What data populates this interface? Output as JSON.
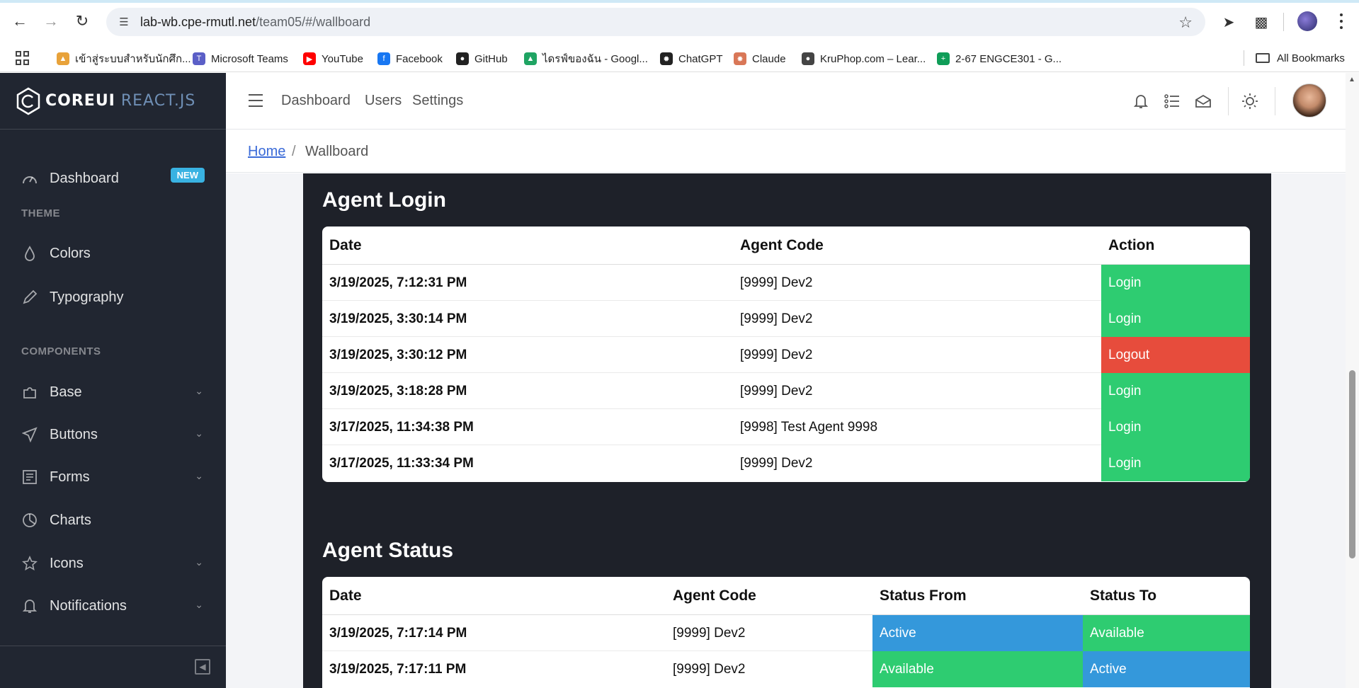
{
  "browser": {
    "url_host": "lab-wb.cpe-rmutl.net",
    "url_path": "/team05/#/wallboard"
  },
  "bookmarks": [
    {
      "label": "เข้าสู่ระบบสำหรับนักศึก...",
      "icon": "flame-icon",
      "color": "#e8a23a"
    },
    {
      "label": "Microsoft Teams",
      "icon": "teams-icon",
      "color": "#5b5fc7"
    },
    {
      "label": "YouTube",
      "icon": "youtube-icon",
      "color": "#ff0000"
    },
    {
      "label": "Facebook",
      "icon": "facebook-icon",
      "color": "#1877f2"
    },
    {
      "label": "GitHub",
      "icon": "github-icon",
      "color": "#222222"
    },
    {
      "label": "ไดรฟ์ของฉัน - Googl...",
      "icon": "drive-icon",
      "color": "#1fa463"
    },
    {
      "label": "ChatGPT",
      "icon": "chatgpt-icon",
      "color": "#222222"
    },
    {
      "label": "Claude",
      "icon": "claude-icon",
      "color": "#d97757"
    },
    {
      "label": "KruPhop.com – Lear...",
      "icon": "kruphop-icon",
      "color": "#444444"
    },
    {
      "label": "2-67 ENGCE301 - G...",
      "icon": "sheets-icon",
      "color": "#0f9d58"
    }
  ],
  "bookmarks_all": "All Bookmarks",
  "sidebar": {
    "brand_bold": "COREUI",
    "brand_light": " REACT.JS",
    "dashboard": {
      "label": "Dashboard",
      "badge": "NEW"
    },
    "theme_title": "THEME",
    "theme_items": [
      {
        "label": "Colors",
        "icon": "drop-icon"
      },
      {
        "label": "Typography",
        "icon": "pencil-icon"
      }
    ],
    "components_title": "COMPONENTS",
    "component_items": [
      {
        "label": "Base",
        "icon": "puzzle-icon",
        "has_children": true
      },
      {
        "label": "Buttons",
        "icon": "cursor-icon",
        "has_children": true
      },
      {
        "label": "Forms",
        "icon": "notes-icon",
        "has_children": true
      },
      {
        "label": "Charts",
        "icon": "chart-pie-icon",
        "has_children": false
      },
      {
        "label": "Icons",
        "icon": "star-icon",
        "has_children": true
      },
      {
        "label": "Notifications",
        "icon": "bell-icon",
        "has_children": true
      }
    ]
  },
  "header": {
    "nav": [
      "Dashboard",
      "Users",
      "Settings"
    ]
  },
  "breadcrumb": {
    "home": "Home",
    "separator": "/",
    "current": "Wallboard"
  },
  "agent_login": {
    "title": "Agent Login",
    "columns": [
      "Date",
      "Agent Code",
      "Action"
    ],
    "rows": [
      {
        "date": "3/19/2025, 7:12:31 PM",
        "agent": "[9999] Dev2",
        "action": "Login",
        "color": "#2ecc71"
      },
      {
        "date": "3/19/2025, 3:30:14 PM",
        "agent": "[9999] Dev2",
        "action": "Login",
        "color": "#2ecc71"
      },
      {
        "date": "3/19/2025, 3:30:12 PM",
        "agent": "[9999] Dev2",
        "action": "Logout",
        "color": "#e74c3c"
      },
      {
        "date": "3/19/2025, 3:18:28 PM",
        "agent": "[9999] Dev2",
        "action": "Login",
        "color": "#2ecc71"
      },
      {
        "date": "3/17/2025, 11:34:38 PM",
        "agent": "[9998] Test Agent 9998",
        "action": "Login",
        "color": "#2ecc71"
      },
      {
        "date": "3/17/2025, 11:33:34 PM",
        "agent": "[9999] Dev2",
        "action": "Login",
        "color": "#2ecc71"
      }
    ]
  },
  "agent_status": {
    "title": "Agent Status",
    "columns": [
      "Date",
      "Agent Code",
      "Status From",
      "Status To"
    ],
    "rows": [
      {
        "date": "3/19/2025, 7:17:14 PM",
        "agent": "[9999] Dev2",
        "from": "Active",
        "from_color": "#3498db",
        "to": "Available",
        "to_color": "#2ecc71"
      },
      {
        "date": "3/19/2025, 7:17:11 PM",
        "agent": "[9999] Dev2",
        "from": "Available",
        "from_color": "#2ecc71",
        "to": "Active",
        "to_color": "#3498db"
      }
    ]
  }
}
